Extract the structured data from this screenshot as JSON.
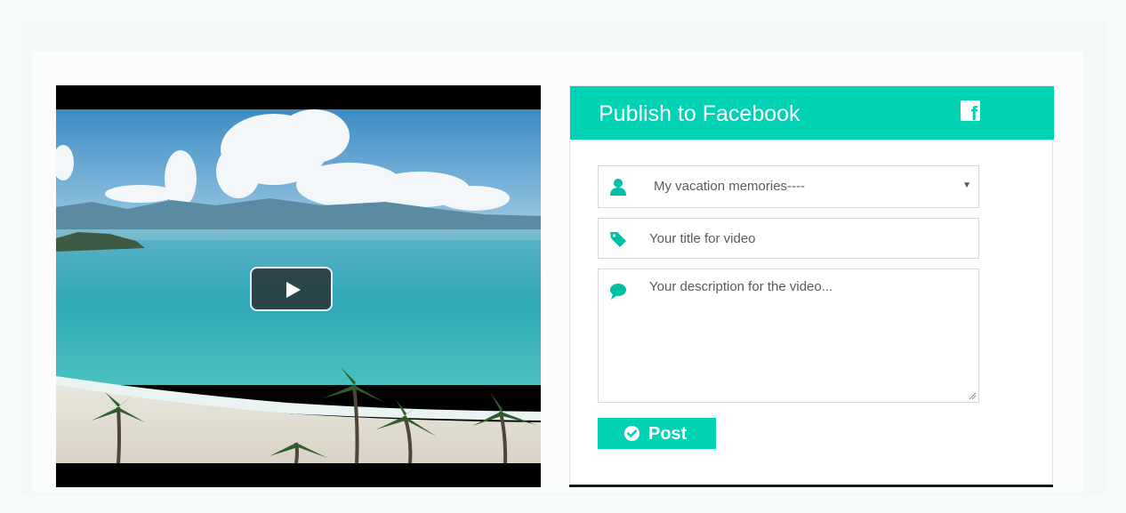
{
  "video": {
    "play_icon": "play-icon"
  },
  "publish_panel": {
    "title": "Publish to Facebook",
    "brand_icon": "facebook-icon",
    "brand_glyph": "f",
    "accent_color": "#00d2b4",
    "album_select": {
      "icon": "user-icon",
      "selected_value": "My vacation memories----",
      "caret_icon": "caret-down-icon"
    },
    "title_field": {
      "icon": "tag-icon",
      "placeholder": "Your title for video",
      "value": ""
    },
    "description_field": {
      "icon": "speech-bubble-icon",
      "placeholder": "Your description for the video...",
      "value": ""
    },
    "post_button": {
      "icon": "check-circle-icon",
      "label": "Post"
    }
  }
}
